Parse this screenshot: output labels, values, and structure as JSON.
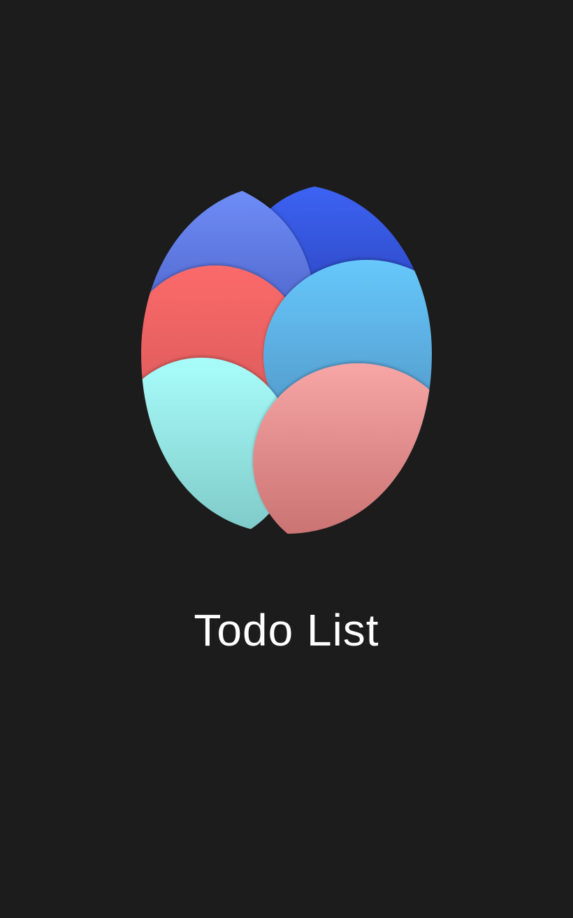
{
  "app": {
    "title": "Todo List"
  },
  "colors": {
    "background": "#1c1c1c",
    "title_text": "#ffffff",
    "petal_blue_light": "#6c8bf5",
    "petal_blue_dark": "#3a5ef0",
    "petal_red": "#f96b6b",
    "petal_sky": "#62c3fb",
    "petal_teal": "#a6fbf8",
    "petal_pink": "#f5a3a3"
  },
  "icons": {
    "logo": "tulip-petals-logo"
  }
}
